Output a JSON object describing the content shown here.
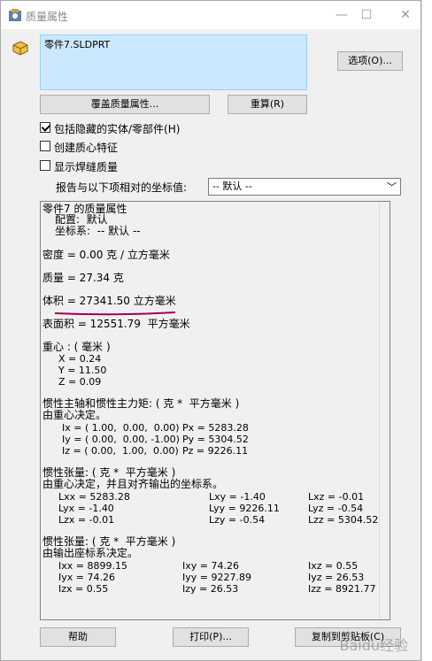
{
  "window": {
    "title": "质量属性"
  },
  "selection": {
    "item": "零件7.SLDPRT"
  },
  "buttons": {
    "options": "选项(O)...",
    "override": "覆盖质量属性...",
    "recalc": "重算(R)",
    "help": "帮助",
    "print": "打印(P)...",
    "copy": "复制到剪贴板(C)"
  },
  "checkboxes": [
    {
      "label": "包括隐藏的实体/零部件(H)",
      "checked": true
    },
    {
      "label": "创建质心特征",
      "checked": false
    },
    {
      "label": "显示焊缝质量",
      "checked": false
    }
  ],
  "coord": {
    "label": "报告与以下项相对的坐标值:",
    "value": "-- 默认 --"
  },
  "results": {
    "title": "零件7 的质量属性",
    "config": "配置:  默认",
    "coordsys": "坐标系:  -- 默认 --",
    "density": "密度 = 0.00 克 / 立方毫米",
    "mass": "质量 = 27.34 克",
    "volume": "体积 = 27341.50 立方毫米",
    "area": "表面积 = 12551.79  平方毫米",
    "centroid_title": "重心 : ( 毫米 )",
    "cx": "X = 0.24",
    "cy": "Y = 11.50",
    "cz": "Z = 0.09",
    "principal_title": "惯性主轴和惯性主力矩: ( 克 *  平方毫米 )",
    "principal_sub": "由重心决定。",
    "ix": "Ix = ( 1.00,  0.00,  0.00)",
    "iy": "Iy = ( 0.00,  0.00, -1.00)",
    "iz": "Iz = ( 0.00,  1.00,  0.00)",
    "px": "Px = 5283.28",
    "py": "Py = 5304.52",
    "pz": "Pz = 9226.11",
    "tensor1_title": "惯性张量: ( 克 *  平方毫米 )",
    "tensor1_sub": "由重心决定，并且对齐输出的坐标系。",
    "t1": [
      [
        "Lxx = 5283.28",
        "Lxy = -1.40",
        "Lxz = -0.01"
      ],
      [
        "Lyx = -1.40",
        "Lyy = 9226.11",
        "Lyz = -0.54"
      ],
      [
        "Lzx = -0.01",
        "Lzy = -0.54",
        "Lzz = 5304.52"
      ]
    ],
    "tensor2_title": "惯性张量: ( 克 *  平方毫米 )",
    "tensor2_sub": "由输出座标系决定。",
    "t2": [
      [
        "Ixx = 8899.15",
        "Ixy = 74.26",
        "Ixz = 0.55"
      ],
      [
        "Iyx = 74.26",
        "Iyy = 9227.89",
        "Iyz = 26.53"
      ],
      [
        "Izx = 0.55",
        "Izy = 26.53",
        "Izz = 8921.77"
      ]
    ]
  },
  "watermark": "Baidu经验",
  "colors": {
    "selection": "#cce8ff",
    "underline": "#a0005a"
  }
}
